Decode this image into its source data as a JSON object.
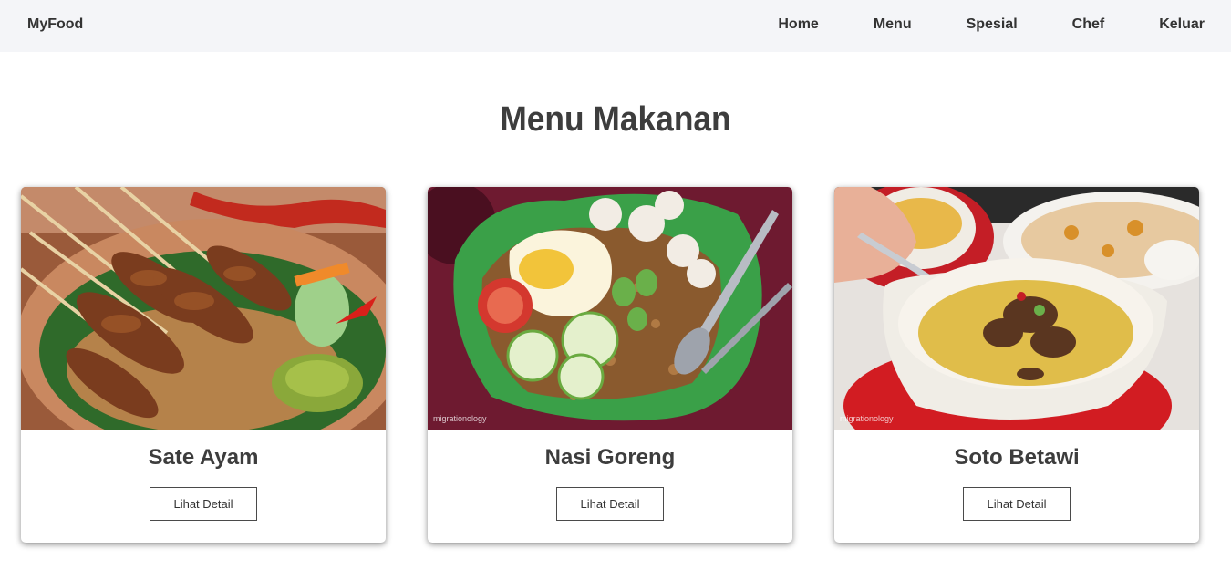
{
  "navbar": {
    "brand": "MyFood",
    "links": [
      "Home",
      "Menu",
      "Spesial",
      "Chef",
      "Keluar"
    ]
  },
  "page": {
    "title": "Menu Makanan"
  },
  "cards": [
    {
      "title": "Sate Ayam",
      "button": "Lihat Detail",
      "image": "sate-ayam-photo"
    },
    {
      "title": "Nasi Goreng",
      "button": "Lihat Detail",
      "image": "nasi-goreng-photo",
      "watermark": "migrationology"
    },
    {
      "title": "Soto Betawi",
      "button": "Lihat Detail",
      "image": "soto-betawi-photo",
      "watermark": "migrationology"
    }
  ],
  "colors": {
    "navbar_bg": "#f4f5f8",
    "text": "#3d3d3d",
    "button_border": "#4a4a4a"
  }
}
